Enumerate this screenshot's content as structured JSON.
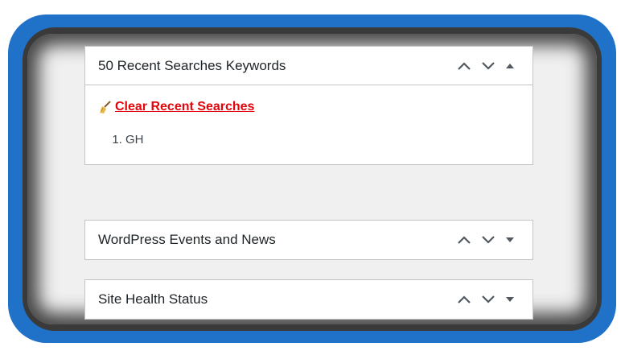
{
  "widgets": [
    {
      "title": "50 Recent Searches Keywords",
      "expanded": true,
      "clear_label": "Clear Recent Searches",
      "keywords": [
        "GH"
      ]
    },
    {
      "title": "WordPress Events and News",
      "expanded": false
    },
    {
      "title": "Site Health Status",
      "expanded": false
    }
  ],
  "colors": {
    "frame": "#1f72c8",
    "link": "#e3040c",
    "background": "#f0f0f1",
    "panel_border": "#c3c4c7"
  },
  "icons": {
    "move_up": "chevron-up-icon",
    "move_down": "chevron-down-icon",
    "toggle_open": "triangle-up-icon",
    "toggle_closed": "triangle-down-icon",
    "clear": "broom-icon"
  }
}
